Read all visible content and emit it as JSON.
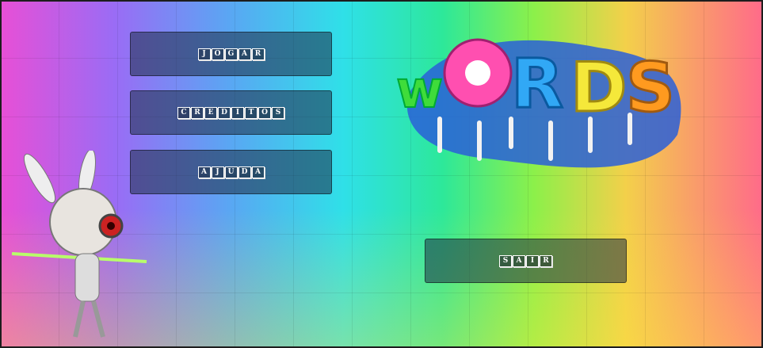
{
  "title": "WORDS",
  "menu": {
    "play": "JOGAR",
    "credits": "CREDITOS",
    "help": "AJUDA",
    "exit": "SAIR"
  },
  "logo_colors": [
    "#3fdc3a",
    "#ff4fb0",
    "#31a8f5",
    "#f5e83a",
    "#ff9a1f"
  ]
}
